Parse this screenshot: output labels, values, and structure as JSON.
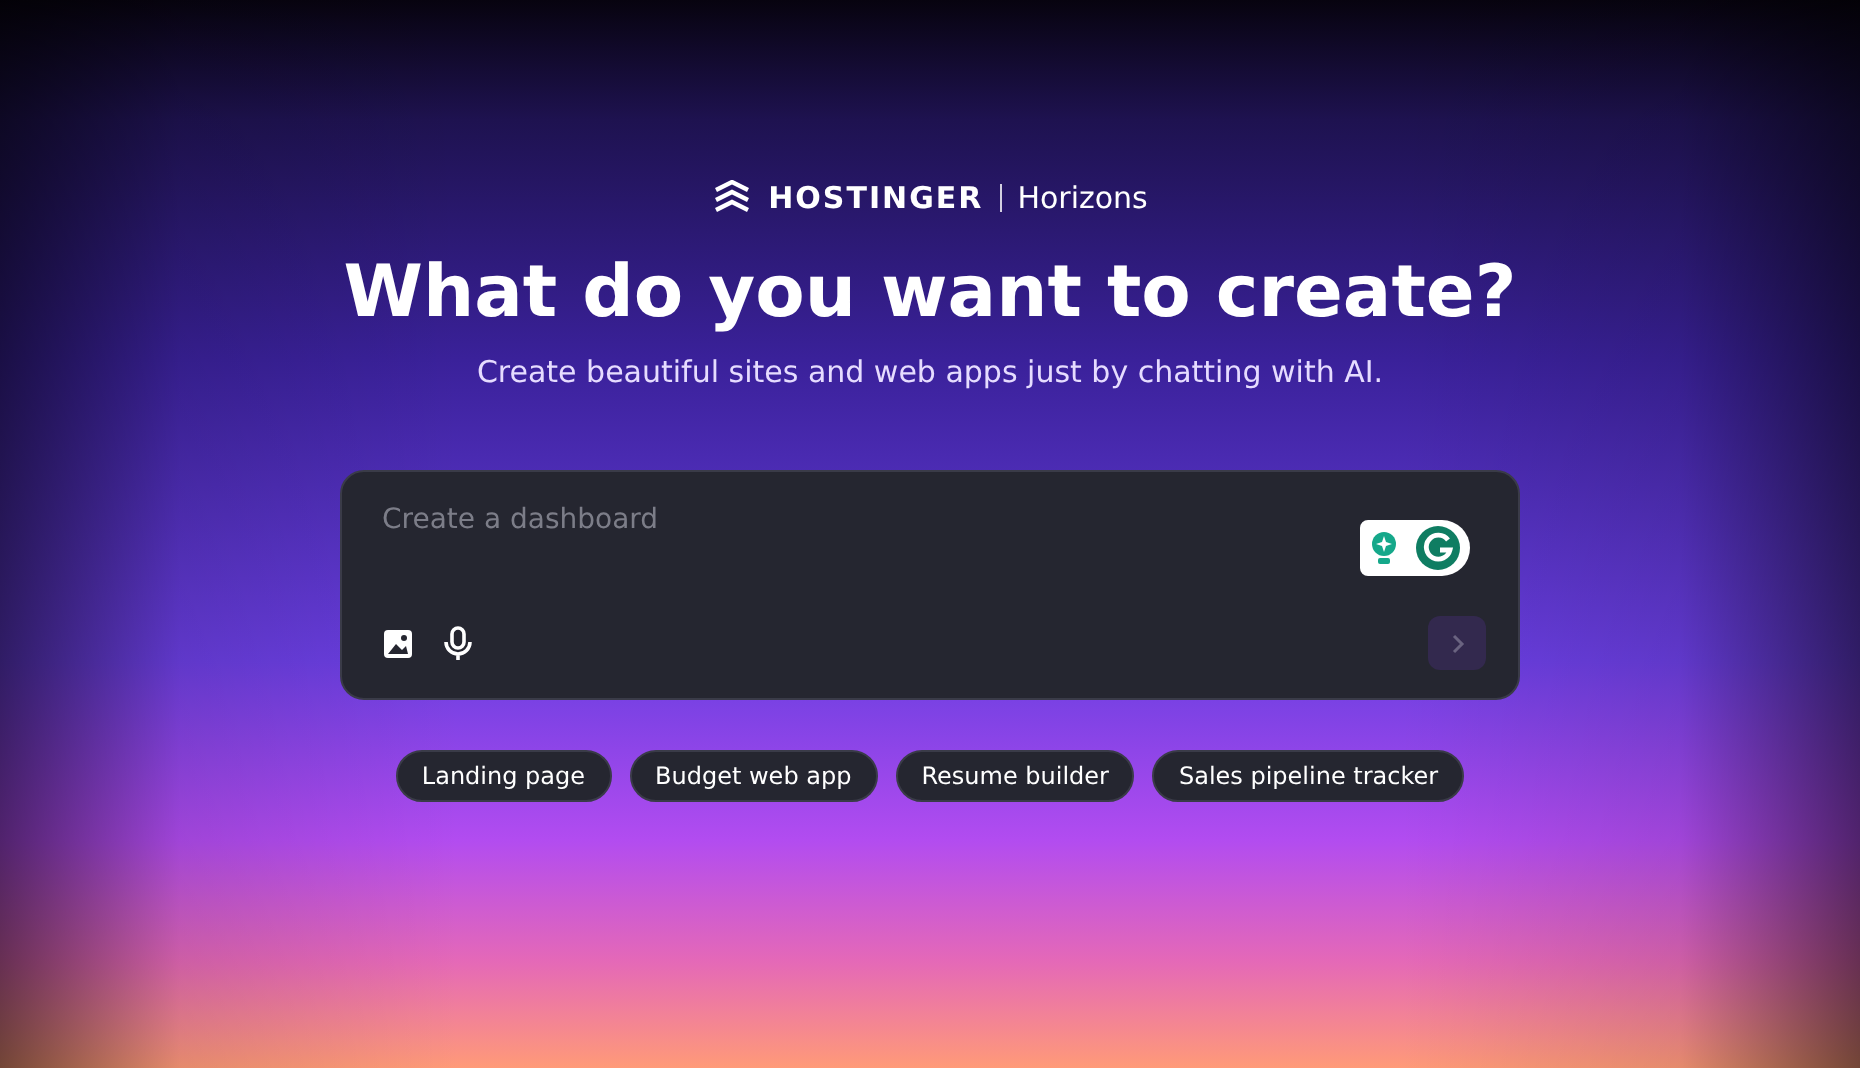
{
  "logo": {
    "brand": "HOSTINGER",
    "product": "Horizons"
  },
  "heading": "What do you want to create?",
  "subheading": "Create beautiful sites and web apps just by chatting with AI.",
  "prompt": {
    "placeholder": "Create a dashboard",
    "send_disabled": true
  },
  "suggestions": [
    "Landing page",
    "Budget web app",
    "Resume builder",
    "Sales pipeline tracker"
  ]
}
